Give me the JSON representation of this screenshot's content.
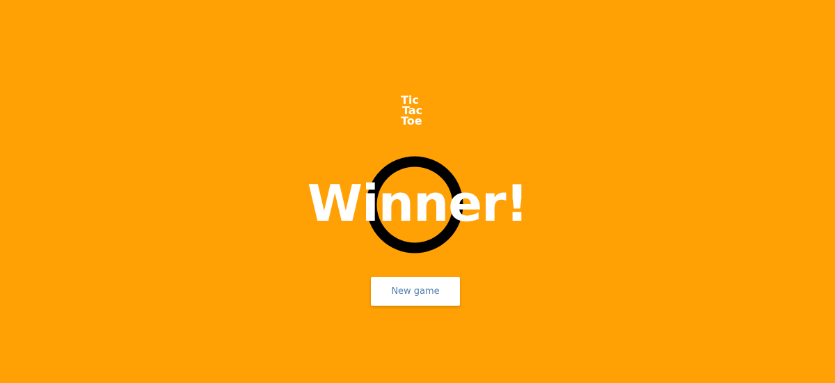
{
  "logo": {
    "line1": "Tic",
    "line2": "Tac",
    "line3": "Toe"
  },
  "result": {
    "title": "Winner!",
    "winner_symbol_icon": "o-mark-icon"
  },
  "actions": {
    "new_game_label": "New game"
  },
  "colors": {
    "background": "#ffa104",
    "text": "#ffffff",
    "ring": "#000000",
    "button_text": "#4f7fb0",
    "button_bg": "#ffffff"
  }
}
